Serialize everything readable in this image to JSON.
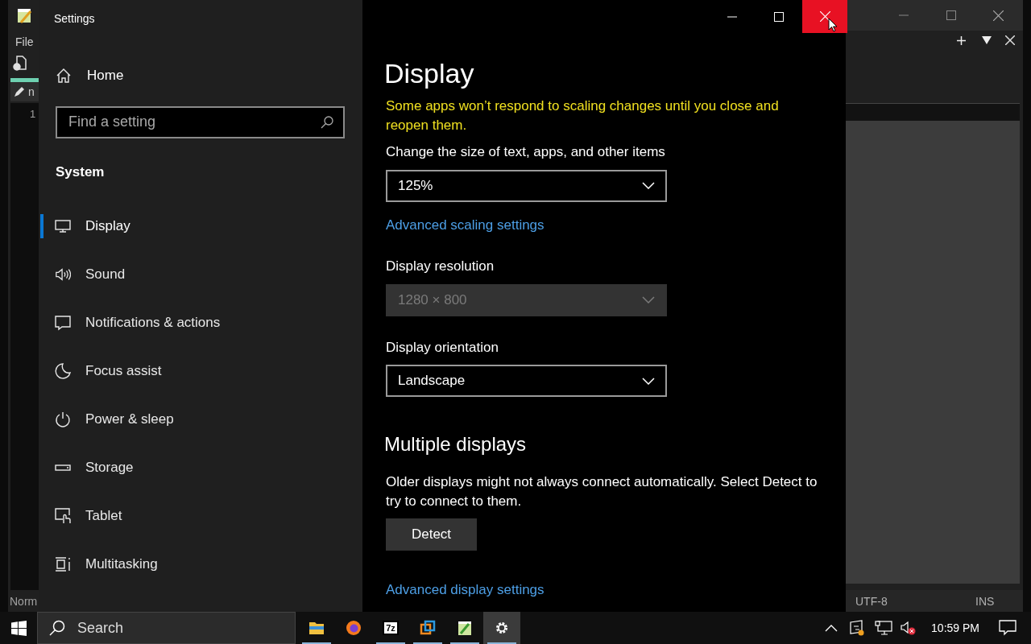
{
  "background_app": {
    "menu": "File",
    "tab": "n",
    "line_number": "1",
    "status_left": "Norm",
    "encoding": "UTF-8",
    "mode": "INS"
  },
  "settings": {
    "title": "Settings",
    "home": "Home",
    "search": {
      "placeholder": "Find a setting"
    },
    "section": "System",
    "nav": [
      {
        "label": "Display",
        "kind": "monitor",
        "selected": true
      },
      {
        "label": "Sound",
        "kind": "speaker",
        "selected": false
      },
      {
        "label": "Notifications & actions",
        "kind": "message",
        "selected": false
      },
      {
        "label": "Focus assist",
        "kind": "moon",
        "selected": false
      },
      {
        "label": "Power & sleep",
        "kind": "power",
        "selected": false
      },
      {
        "label": "Storage",
        "kind": "drive",
        "selected": false
      },
      {
        "label": "Tablet",
        "kind": "tablet",
        "selected": false
      },
      {
        "label": "Multitasking",
        "kind": "multitask",
        "selected": false
      }
    ],
    "page_title": "Display",
    "warning": "Some apps won’t respond to scaling changes until you close and reopen them.",
    "fields": [
      {
        "kind": "dropdown",
        "label": "Change the size of text, apps, and other items",
        "value": "125%",
        "disabled": false
      },
      {
        "kind": "link",
        "label": "Advanced scaling settings"
      },
      {
        "kind": "dropdown",
        "label": "Display resolution",
        "value": "1280 × 800",
        "disabled": true
      },
      {
        "kind": "dropdown",
        "label": "Display orientation",
        "value": "Landscape",
        "disabled": false
      }
    ],
    "multiple_heading": "Multiple displays",
    "multiple_text": "Older displays might not always connect automatically. Select Detect to try to connect to them.",
    "detect_button": "Detect",
    "advanced_link": "Advanced display settings"
  },
  "taskbar": {
    "search_placeholder": "Search",
    "apps": [
      {
        "kind": "folder",
        "running": true,
        "selected": false
      },
      {
        "kind": "browser",
        "running": false,
        "selected": false
      },
      {
        "kind": "archiver",
        "text": "7z",
        "running": true,
        "selected": false
      },
      {
        "kind": "boxes",
        "running": true,
        "selected": false
      },
      {
        "kind": "notepad",
        "running": true,
        "selected": false
      },
      {
        "kind": "gear",
        "running": true,
        "selected": true
      }
    ],
    "time": "10:59 PM"
  }
}
